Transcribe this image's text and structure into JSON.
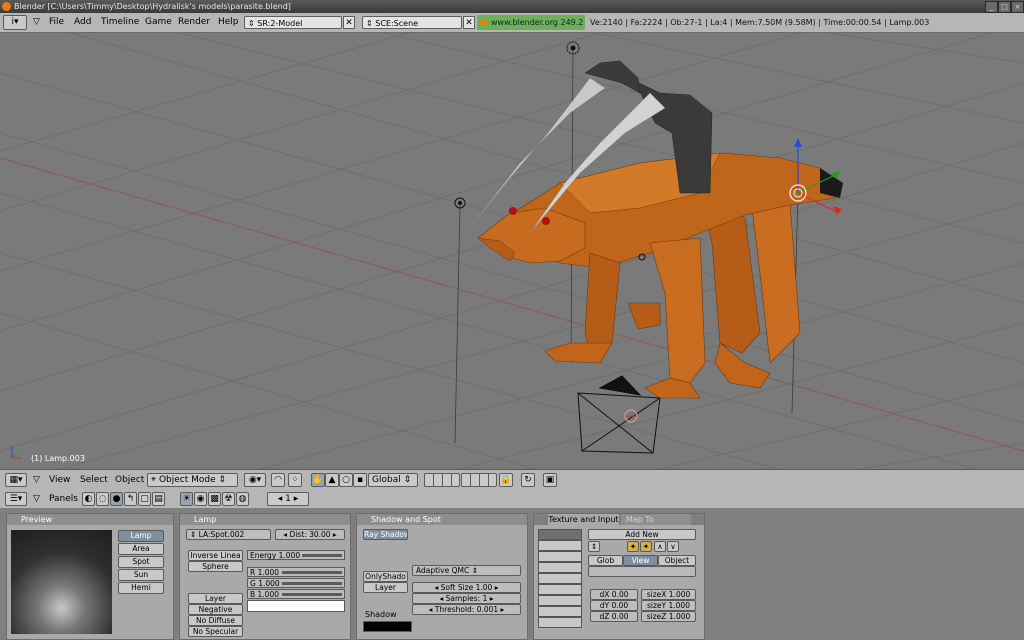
{
  "window": {
    "title": "Blender [C:\\Users\\Timmy\\Desktop\\Hydralisk's models\\parasite.blend]"
  },
  "top_header": {
    "menus": [
      "File",
      "Add",
      "Timeline",
      "Game",
      "Render",
      "Help"
    ],
    "screen_field": "SR:2-Model",
    "scene_field": "SCE:Scene",
    "website": "www.blender.org 249.2",
    "stats": "Ve:2140 | Fa:2224 | Ob:27-1 | La:4  | Mem:7.50M (9.58M)  | Time:00:00.54 | Lamp.003"
  },
  "viewport": {
    "object_label": "(1) Lamp.003"
  },
  "view3d_header": {
    "menus": [
      "View",
      "Select",
      "Object"
    ],
    "mode": "Object Mode",
    "orientation": "Global"
  },
  "buttons_header": {
    "panels_label": "Panels",
    "frame": "1"
  },
  "preview_panel": {
    "title": "Preview",
    "types": [
      "Lamp",
      "Area",
      "Spot",
      "Sun",
      "Hemi"
    ],
    "selected": "Lamp"
  },
  "lamp_panel": {
    "title": "Lamp",
    "name_field": "LA:Spot.002",
    "dist": "Dist: 30.00",
    "falloff_type": "Inverse Linea",
    "sphere": "Sphere",
    "energy": "Energy 1.000",
    "r": "R 1.000",
    "g": "G 1.000",
    "b": "B 1.000",
    "toggles": [
      "Layer",
      "Negative",
      "No Diffuse",
      "No Specular"
    ]
  },
  "shadow_panel": {
    "title": "Shadow and Spot",
    "ray_shadow": "Ray Shadow",
    "sampling": "Adaptive QMC",
    "only_shadow": "OnlyShado",
    "layer": "Layer",
    "soft_size": "Soft Size 1.00",
    "samples": "Samples: 1",
    "threshold": "Threshold: 0.001",
    "shadow_label": "Shadow",
    "shadow_color": "#000000"
  },
  "texture_panel": {
    "tabs": [
      "Texture and Input",
      "Map To"
    ],
    "add_new": "Add New",
    "coords": [
      "Glob",
      "View",
      "Object"
    ],
    "selected_coord": "View",
    "dx": "dX 0.00",
    "dy": "dY 0.00",
    "dz": "dZ 0.00",
    "sizex": "sizeX 1.000",
    "sizey": "sizeY 1.000",
    "sizez": "sizeZ 1.000"
  },
  "colors": {
    "header": "#b6b6b6",
    "viewport": "#7a7a7a",
    "model": "#c0661a",
    "claw": "#bdbdbd",
    "website_bg": "#6db05a"
  }
}
